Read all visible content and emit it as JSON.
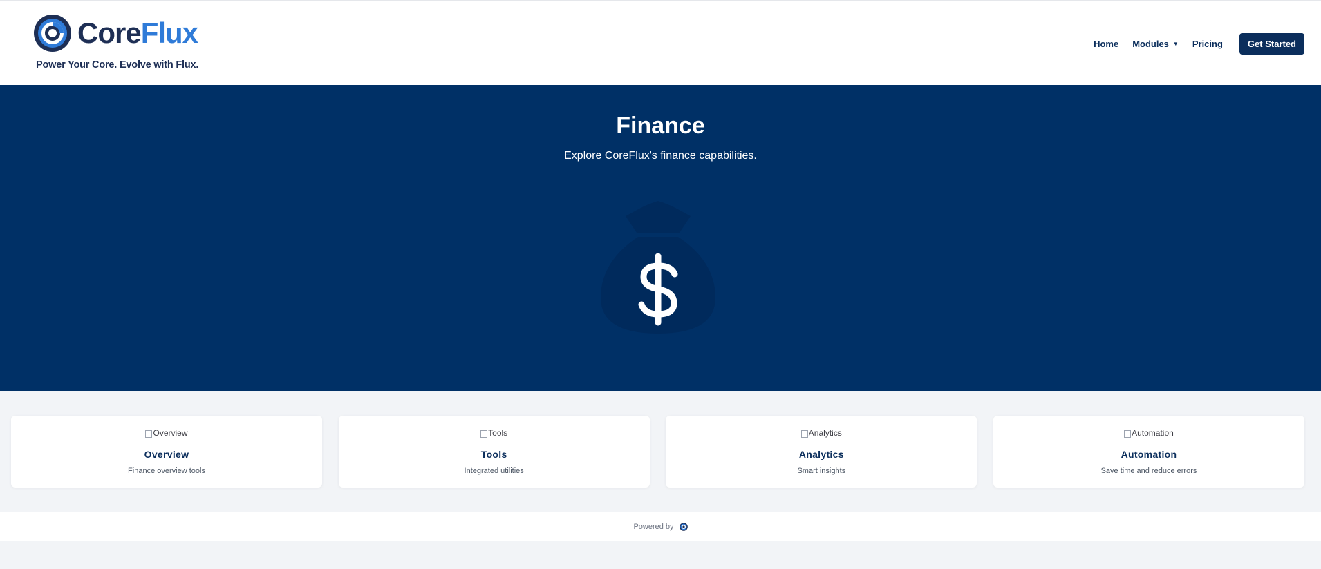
{
  "brand": {
    "name_part1": "Core",
    "name_part2": "Flux",
    "tagline": "Power Your Core. Evolve with Flux."
  },
  "nav": {
    "home": "Home",
    "modules": "Modules",
    "pricing": "Pricing",
    "cta": "Get Started"
  },
  "hero": {
    "title": "Finance",
    "subtitle": "Explore CoreFlux's finance capabilities.",
    "icon": "money-bag-icon"
  },
  "cards": [
    {
      "img_alt": "Overview",
      "title": "Overview",
      "desc": "Finance overview tools"
    },
    {
      "img_alt": "Tools",
      "title": "Tools",
      "desc": "Integrated utilities"
    },
    {
      "img_alt": "Analytics",
      "title": "Analytics",
      "desc": "Smart insights"
    },
    {
      "img_alt": "Automation",
      "title": "Automation",
      "desc": "Save time and reduce errors"
    }
  ],
  "footer": {
    "powered_by": "Powered by"
  },
  "colors": {
    "primary": "#003066",
    "accent": "#2f7bd8",
    "background": "#f2f4f7"
  }
}
